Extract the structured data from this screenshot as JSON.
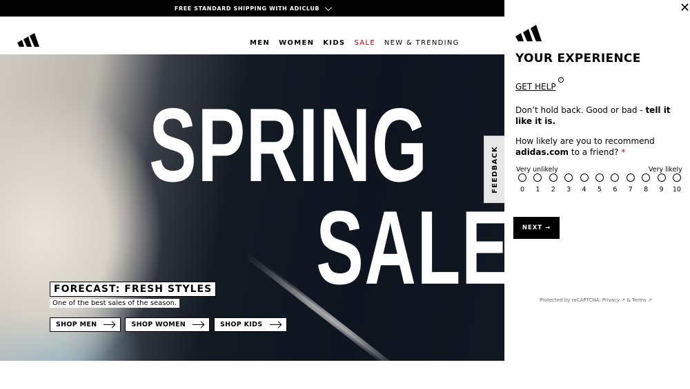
{
  "topbar": {
    "text": "FREE STANDARD SHIPPING WITH ADICLUB"
  },
  "header": {
    "logo": "adidas-logo",
    "nav": [
      "MEN",
      "WOMEN",
      "KIDS",
      "SALE",
      "NEW & TRENDING"
    ]
  },
  "hero": {
    "line1": "SPRING",
    "line2": "SALE",
    "tagline": "FORECAST: FRESH STYLES",
    "subline": "One of the best sales of the season.",
    "buttons": [
      "SHOP MEN",
      "SHOP WOMEN",
      "SHOP KIDS"
    ]
  },
  "feedback_tab": "FEEDBACK",
  "panel": {
    "close": "✕",
    "title": "YOUR EXPERIENCE",
    "get_help": "GET HELP",
    "intro_plain": "Don’t hold back. Good or bad - ",
    "intro_bold": "tell it like it is.",
    "question_pre": "How likely are you to recommend ",
    "question_bold": "adidas.com",
    "question_post": " to a friend? ",
    "required_mark": "*",
    "low_label": "Very unlikely",
    "high_label": "Very likely",
    "scale": [
      "0",
      "1",
      "2",
      "3",
      "4",
      "5",
      "6",
      "7",
      "8",
      "9",
      "10"
    ],
    "next_label": "NEXT →",
    "recaptcha": "Protected by reCAPTCHA: Privacy ↗ & Terms ↗"
  }
}
